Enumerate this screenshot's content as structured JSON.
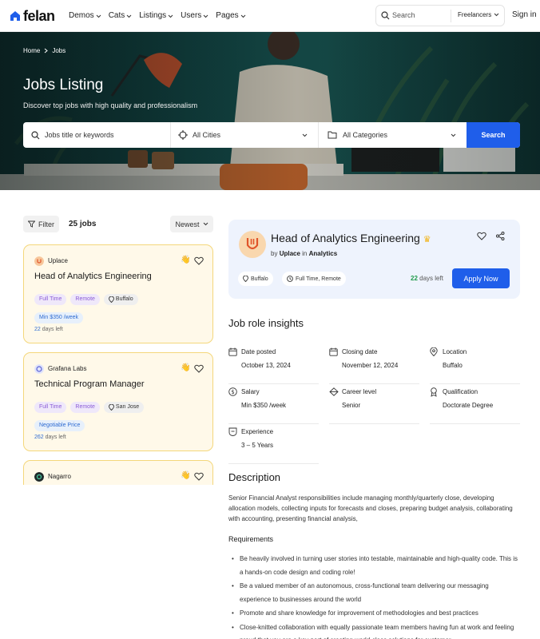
{
  "nav": {
    "logo": "felan",
    "menu": [
      "Demos",
      "Cats",
      "Listings",
      "Users",
      "Pages"
    ],
    "search_placeholder": "Search",
    "search_scope": "Freelancers",
    "signin": "Sign in"
  },
  "hero": {
    "breadcrumb": [
      "Home",
      "Jobs"
    ],
    "title": "Jobs Listing",
    "subtitle": "Discover top jobs with high quality and professionalism",
    "keyword_placeholder": "Jobs title or keywords",
    "city": "All Cities",
    "category": "All Categories",
    "search_label": "Search"
  },
  "list": {
    "filter_label": "Filter",
    "count": "25 jobs",
    "sort": "Newest",
    "jobs": [
      {
        "company": "Uplace",
        "title": "Head of Analytics Engineering",
        "type": "Full Time",
        "mode": "Remote",
        "location": "Buffalo",
        "salary": "Min $350 /week",
        "days": "22",
        "days_suffix": "days left"
      },
      {
        "company": "Grafana Labs",
        "title": "Technical Program Manager",
        "type": "Full Time",
        "mode": "Remote",
        "location": "San Jose",
        "salary": "Negotiable Price",
        "days": "262",
        "days_suffix": "days left"
      },
      {
        "company": "Nagarro"
      }
    ]
  },
  "detail": {
    "title": "Head of Analytics Engineering",
    "by": "by",
    "company": "Uplace",
    "in": "in",
    "category": "Analytics",
    "location": "Buffalo",
    "job_type": "Full Time, Remote",
    "days": "22",
    "days_suffix": "days left",
    "apply_label": "Apply Now",
    "insights_title": "Job role insights",
    "insights": [
      {
        "label": "Date posted",
        "value": "October 13, 2024",
        "icon": "calendar-icon"
      },
      {
        "label": "Closing date",
        "value": "November 12, 2024",
        "icon": "calendar-icon"
      },
      {
        "label": "Location",
        "value": "Buffalo",
        "icon": "map-pin-icon"
      },
      {
        "label": "Salary",
        "value": "Min $350 /week",
        "icon": "dollar-icon"
      },
      {
        "label": "Career level",
        "value": "Senior",
        "icon": "career-icon"
      },
      {
        "label": "Qualification",
        "value": "Doctorate Degree",
        "icon": "award-icon"
      },
      {
        "label": "Experience",
        "value": "3 – 5 Years",
        "icon": "experience-icon"
      }
    ],
    "description_title": "Description",
    "description": "Senior Financial Analyst responsibilities include managing monthly/quarterly close, developing allocation models, collecting inputs for forecasts and closes, preparing budget analysis, collaborating with accounting, presenting financial analysis,",
    "requirements_title": "Requirements",
    "requirements": [
      "Be heavily involved in turning user stories into testable, maintainable and high-quality code. This is a hands-on code design and coding role!",
      "Be a valued member of an autonomous, cross-functional team delivering our messaging experience to businesses around the world",
      "Promote and share knowledge for improvement of methodologies and best practices",
      "Close-knitted collaboration with equally passionate team members having fun at work and feeling proud that you are a key part of creating world-class solutions for customer"
    ]
  },
  "colors": {
    "accent": "#1f5eea",
    "card_bg": "#fff9e9",
    "card_border": "#f4d77b",
    "detail_bg": "#eef3fd",
    "days_green": "#1f9b4a"
  }
}
